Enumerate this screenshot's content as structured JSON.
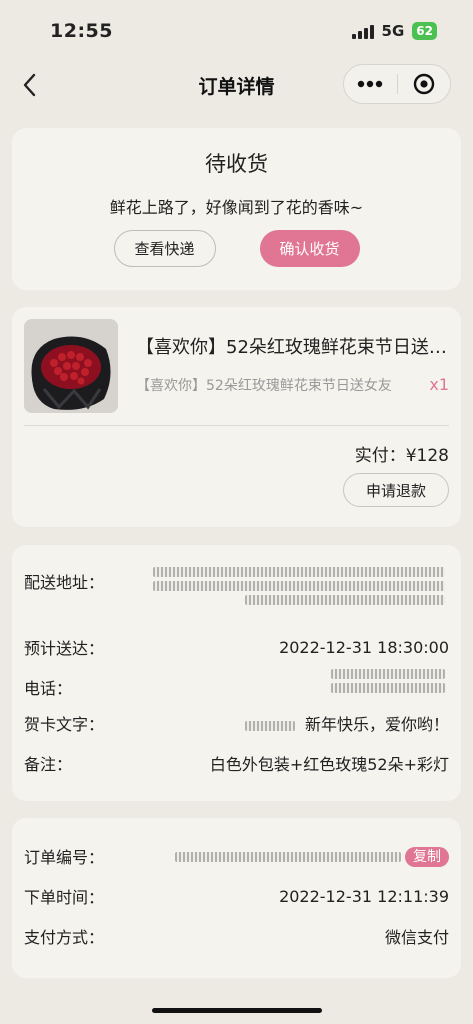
{
  "status_bar": {
    "time": "12:55",
    "network": "5G",
    "battery": "62"
  },
  "nav": {
    "title": "订单详情"
  },
  "status_card": {
    "title": "待收货",
    "subtitle": "鲜花上路了，好像闻到了花的香味~",
    "check_delivery_label": "查看快递",
    "confirm_receipt_label": "确认收货"
  },
  "product": {
    "name": "【喜欢你】52朵红玫瑰鲜花束节日送女友",
    "spec": "【喜欢你】52朵红玫瑰鲜花束节日送女友",
    "quantity": "x1",
    "paid_label": "实付：",
    "paid_amount": "¥128",
    "refund_label": "申请退款"
  },
  "delivery_info": {
    "address_label": "配送地址：",
    "eta_label": "预计送达：",
    "eta_value": "2022-12-31 18:30:00",
    "phone_label": "电话：",
    "card_label": "贺卡文字：",
    "card_value": "新年快乐，爱你哟！",
    "note_label": "备注：",
    "note_value": "白色外包装+红色玫瑰52朵+彩灯"
  },
  "order_info": {
    "order_no_label": "订单编号：",
    "copy_label": "复制",
    "order_time_label": "下单时间：",
    "order_time_value": "2022-12-31 12:11:39",
    "payment_label": "支付方式：",
    "payment_value": "微信支付"
  },
  "colors": {
    "accent_pink": "#e07594",
    "background": "#eceae2",
    "card": "#f4f3ee"
  }
}
